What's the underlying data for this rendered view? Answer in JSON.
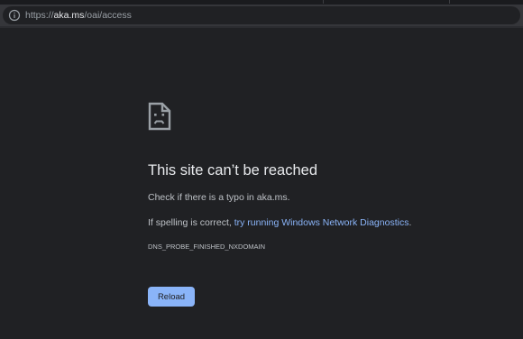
{
  "browser": {
    "address_bar": {
      "url_scheme": "https://",
      "url_domain": "aka.ms",
      "url_path": "/oai/access",
      "info_icon": "info-circle-icon"
    }
  },
  "error_page": {
    "icon": "sad-file-icon",
    "heading": "This site can’t be reached",
    "check_text": "Check if there is a typo in aka.ms.",
    "spelling_prefix": "If spelling is correct, ",
    "diagnostics_link": "try running Windows Network Diagnostics",
    "spelling_suffix": ".",
    "error_code": "DNS_PROBE_FINISHED_NXDOMAIN",
    "reload_label": "Reload"
  },
  "colors": {
    "page_background": "#202124",
    "toolbar": "#35363a",
    "link": "#8ab4f8",
    "button": "#8ab4f8",
    "heading_text": "#e8eaed",
    "body_text": "#bdc1c6"
  }
}
